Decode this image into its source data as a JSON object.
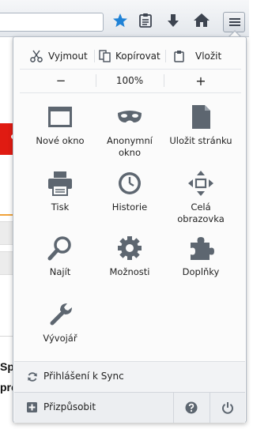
{
  "toolbar": {
    "icons": [
      "star-icon",
      "reading-list-icon",
      "download-icon",
      "home-icon",
      "menu-icon"
    ]
  },
  "background": {
    "text_lines": [
      "Spo",
      "pro"
    ]
  },
  "panel": {
    "edit": {
      "cut_label": "Vyjmout",
      "copy_label": "Kopírovat",
      "paste_label": "Vložit"
    },
    "zoom": {
      "out_label": "−",
      "level": "100%",
      "in_label": "+"
    },
    "items": [
      {
        "label": "Nové okno",
        "icon": "new-window-icon"
      },
      {
        "label": "Anonymní\nokno",
        "icon": "private-window-icon"
      },
      {
        "label": "Uložit stránku",
        "icon": "save-page-icon"
      },
      {
        "label": "Tisk",
        "icon": "print-icon"
      },
      {
        "label": "Historie",
        "icon": "history-icon"
      },
      {
        "label": "Celá\nobrazovka",
        "icon": "fullscreen-icon"
      },
      {
        "label": "Najít",
        "icon": "find-icon"
      },
      {
        "label": "Možnosti",
        "icon": "options-icon"
      },
      {
        "label": "Doplňky",
        "icon": "addons-icon"
      },
      {
        "label": "Vývojář",
        "icon": "developer-icon"
      }
    ],
    "sync_label": "Přihlášení k Sync",
    "customize_label": "Přizpůsobit",
    "help_icon": "help-icon",
    "quit_icon": "power-icon"
  },
  "colors": {
    "icon_gray": "#5d6670",
    "star_blue": "#1f82d6",
    "background_red": "#e01b12"
  }
}
